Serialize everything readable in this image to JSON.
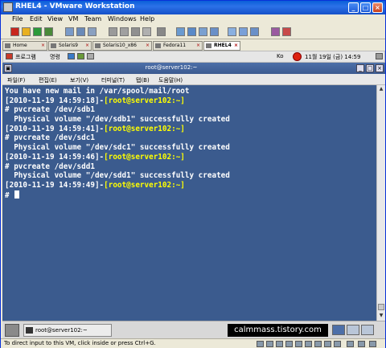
{
  "window": {
    "title": "RHEL4 - VMware Workstation"
  },
  "menu": [
    "File",
    "Edit",
    "View",
    "VM",
    "Team",
    "Windows",
    "Help"
  ],
  "tabs": [
    {
      "label": "Home",
      "active": false
    },
    {
      "label": "Solaris9",
      "active": false
    },
    {
      "label": "Solaris10_x86",
      "active": false
    },
    {
      "label": "Fedora11",
      "active": false
    },
    {
      "label": "RHEL4",
      "active": true
    }
  ],
  "guest_bar": {
    "applications": "프로그램",
    "places": "명령",
    "ime": "Ko",
    "datetime": "11월 19일 (금)  14:59"
  },
  "terminal": {
    "title": "root@server102:~",
    "menu": [
      "파일(F)",
      "편집(E)",
      "보기(V)",
      "터미널(T)",
      "탭(B)",
      "도움말(H)"
    ],
    "lines": [
      {
        "text": "You have new mail in /var/spool/mail/root",
        "kind": "out"
      },
      {
        "stamp": "[2010-11-19 14:59:18]-",
        "prompt": "[root@server102:~]",
        "kind": "prompt"
      },
      {
        "text": "# pvcreate /dev/sdb1",
        "kind": "out"
      },
      {
        "text": "  Physical volume \"/dev/sdb1\" successfully created",
        "kind": "out"
      },
      {
        "stamp": "[2010-11-19 14:59:41]-",
        "prompt": "[root@server102:~]",
        "kind": "prompt"
      },
      {
        "text": "# pvcreate /dev/sdc1",
        "kind": "out"
      },
      {
        "text": "  Physical volume \"/dev/sdc1\" successfully created",
        "kind": "out"
      },
      {
        "stamp": "[2010-11-19 14:59:46]-",
        "prompt": "[root@server102:~]",
        "kind": "prompt"
      },
      {
        "text": "# pvcreate /dev/sdd1",
        "kind": "out"
      },
      {
        "text": "  Physical volume \"/dev/sdd1\" successfully created",
        "kind": "out"
      },
      {
        "stamp": "[2010-11-19 14:59:49]-",
        "prompt": "[root@server102:~]",
        "kind": "prompt"
      },
      {
        "text": "#",
        "kind": "cursor"
      }
    ]
  },
  "taskbar": {
    "task_label": "root@server102:~",
    "watermark": "calmmass.tistory.com"
  },
  "status": {
    "hint": "To direct input to this VM, click inside or press Ctrl+G."
  },
  "colors": {
    "terminal_bg": "#3b5b8e",
    "prompt_yellow": "#ffff00",
    "title_blue": "#0a5fd8"
  }
}
